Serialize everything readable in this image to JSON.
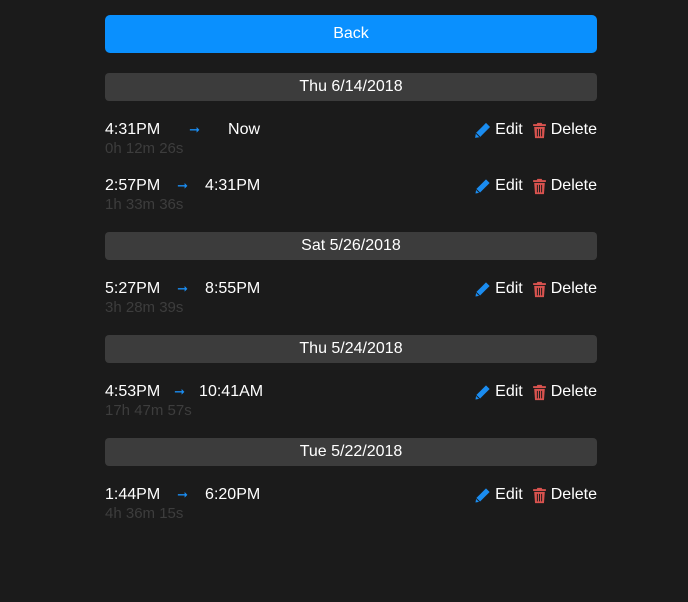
{
  "back_label": "Back",
  "action_labels": {
    "edit": "Edit",
    "delete": "Delete"
  },
  "arrow": "➞",
  "colors": {
    "accent": "#0a90fe",
    "edit_icon": "#1a8cf0",
    "delete_icon": "#d9534f",
    "header_bg": "#3c3c3c",
    "duration_text": "#3d3d3d",
    "page_bg": "#1b1b1b"
  },
  "days": [
    {
      "date": "Thu 6/14/2018",
      "entries": [
        {
          "start": "4:31PM",
          "end": "Now",
          "duration": "0h 12m 26s"
        },
        {
          "start": "2:57PM",
          "end": "4:31PM",
          "duration": "1h 33m 36s"
        }
      ]
    },
    {
      "date": "Sat 5/26/2018",
      "entries": [
        {
          "start": "5:27PM",
          "end": "8:55PM",
          "duration": "3h 28m 39s"
        }
      ]
    },
    {
      "date": "Thu 5/24/2018",
      "entries": [
        {
          "start": "4:53PM",
          "end": "10:41AM",
          "duration": "17h 47m 57s"
        }
      ]
    },
    {
      "date": "Tue 5/22/2018",
      "entries": [
        {
          "start": "1:44PM",
          "end": "6:20PM",
          "duration": "4h 36m 15s"
        }
      ]
    }
  ]
}
